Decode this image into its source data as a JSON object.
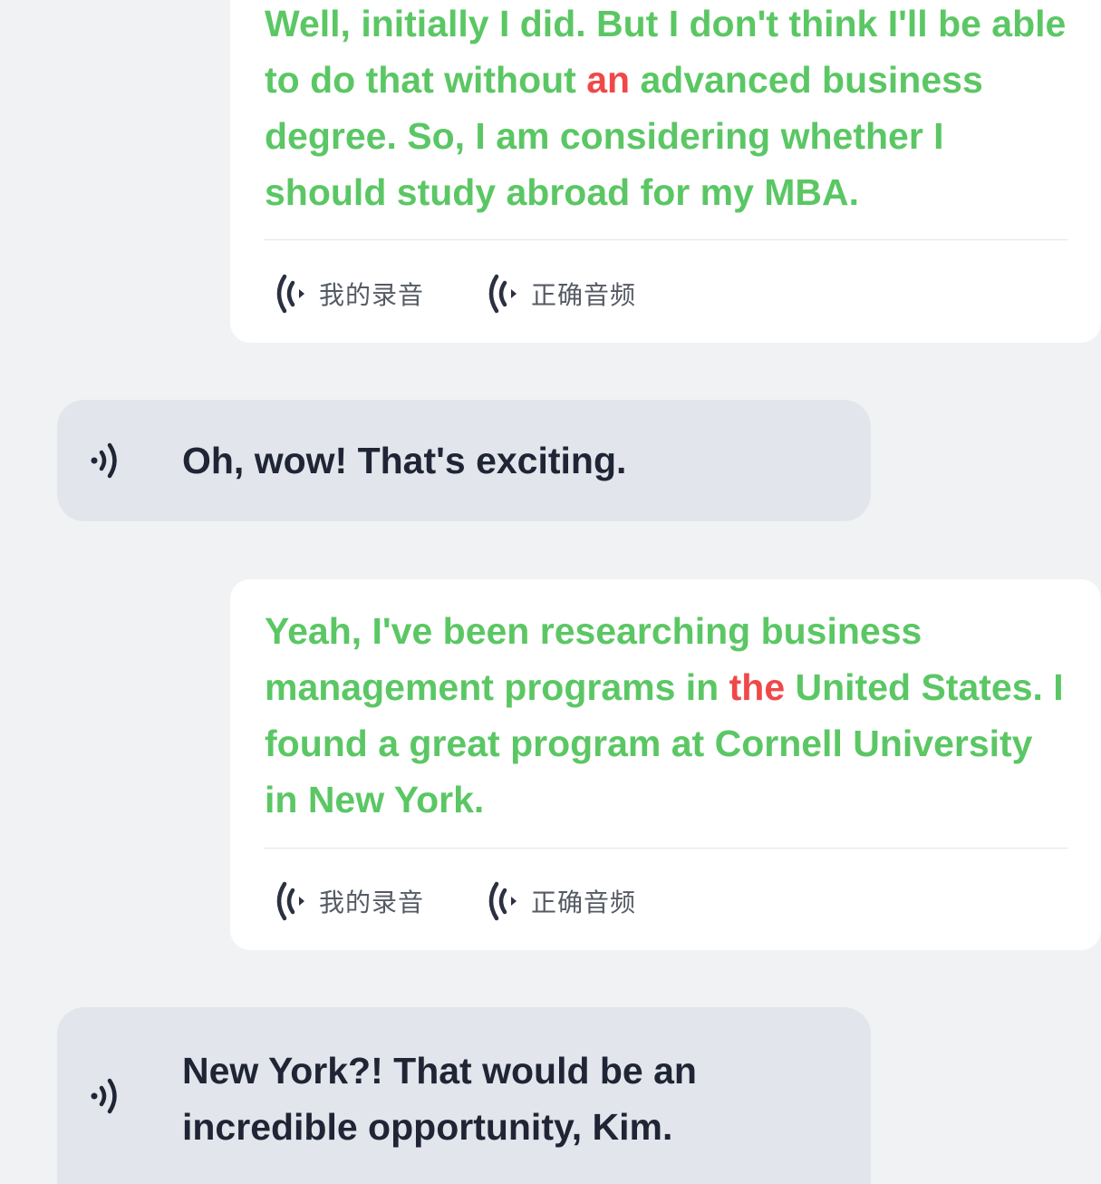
{
  "messages": [
    {
      "role": "user",
      "segments": [
        {
          "text": "Well, initially I did. But I don't think I'll be able to do that without ",
          "error": false
        },
        {
          "text": "an",
          "error": true
        },
        {
          "text": " advanced business degree. So, I am considering whether I should study abroad for my MBA.",
          "error": false
        }
      ],
      "my_recording_label": "我的录音",
      "correct_audio_label": "正确音频"
    },
    {
      "role": "partner",
      "text": "Oh, wow! That's exciting."
    },
    {
      "role": "user",
      "segments": [
        {
          "text": "Yeah, I've been researching business management programs in ",
          "error": false
        },
        {
          "text": "the",
          "error": true
        },
        {
          "text": " United States. I found a great program at Cornell University in New York.",
          "error": false
        }
      ],
      "my_recording_label": "我的录音",
      "correct_audio_label": "正确音频"
    },
    {
      "role": "partner",
      "text": "New York?! That would be an incredible opportunity, Kim."
    }
  ],
  "colors": {
    "correct_text": "#5bc764",
    "error_text": "#f04848",
    "partner_text": "#1f2535",
    "partner_bubble": "#e2e5eb",
    "user_card": "#ffffff",
    "background": "#f1f2f4"
  },
  "icons": {
    "audio_button_icon": "wifi-wave-left-icon",
    "partner_speaker_icon": "speaker-wave-icon"
  }
}
